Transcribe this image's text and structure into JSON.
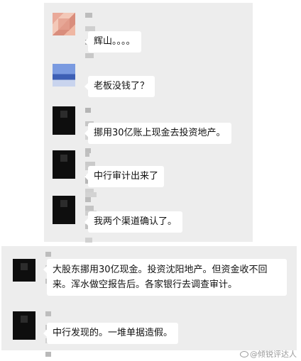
{
  "chat": {
    "messages": [
      {
        "avatar": "pink-mosaic-avatar",
        "text": "辉山。。。。"
      },
      {
        "avatar": "blue-mosaic-avatar",
        "text": "老板没钱了？"
      },
      {
        "avatar": "dark-mosaic-avatar",
        "text": "挪用30亿账上现金去投资地产。"
      },
      {
        "avatar": "dark-mosaic-avatar",
        "text": "中行审计出来了"
      },
      {
        "avatar": "dark-mosaic-avatar",
        "text": "我两个渠道确认了。"
      },
      {
        "avatar": "dark-mosaic-avatar",
        "text": "大股东挪用30亿现金。投资沈阳地产。但资金收不回来。浑水做空报告后。各家银行去调查审计。"
      },
      {
        "avatar": "dark-mosaic-avatar",
        "text": "中行发现的。一堆单据造假。"
      }
    ]
  },
  "watermark": {
    "text": "@倾锐评达人"
  },
  "colors": {
    "panel": "#ededed",
    "bubble": "#ffffff",
    "text": "#111111"
  }
}
